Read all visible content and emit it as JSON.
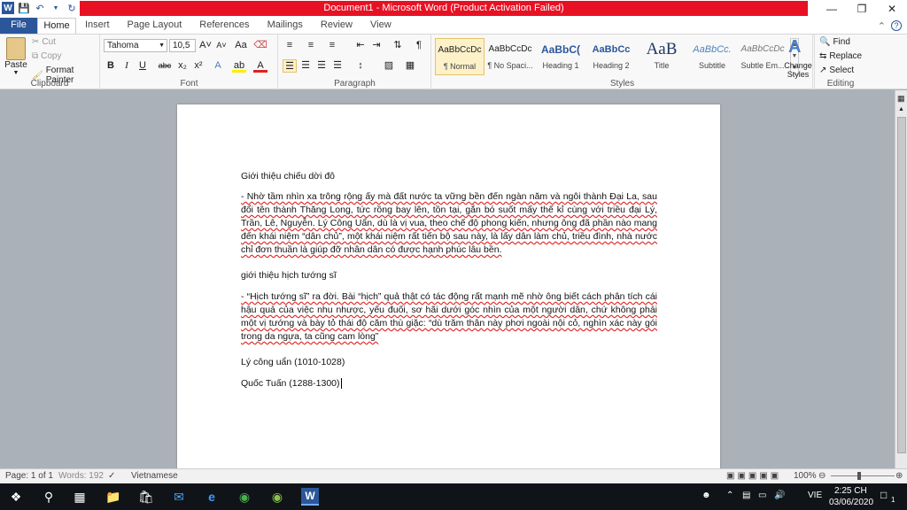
{
  "window": {
    "title": "Document1  -  Microsoft Word (Product Activation Failed)"
  },
  "tabs": [
    "File",
    "Home",
    "Insert",
    "Page Layout",
    "References",
    "Mailings",
    "Review",
    "View"
  ],
  "clipboard": {
    "paste": "Paste",
    "cut": "Cut",
    "copy": "Copy",
    "format_painter": "Format Painter",
    "label": "Clipboard"
  },
  "font": {
    "name": "Tahoma",
    "size": "10,5",
    "label": "Font"
  },
  "paragraph": {
    "label": "Paragraph"
  },
  "styles": {
    "label": "Styles",
    "items": [
      {
        "sample": "AaBbCcDc",
        "name": "¶ Normal"
      },
      {
        "sample": "AaBbCcDc",
        "name": "¶ No Spaci..."
      },
      {
        "sample": "AaBbC(",
        "name": "Heading 1"
      },
      {
        "sample": "AaBbCc",
        "name": "Heading 2"
      },
      {
        "sample": "AaB",
        "name": "Title"
      },
      {
        "sample": "AaBbCc.",
        "name": "Subtitle"
      },
      {
        "sample": "AaBbCcDc",
        "name": "Subtle Em..."
      }
    ],
    "change": "Change Styles"
  },
  "editing": {
    "find": "Find",
    "replace": "Replace",
    "select": "Select",
    "label": "Editing"
  },
  "document": {
    "p1": "Giới thiệu chiếu dời đô",
    "p2": "-     Nhờ tầm nhìn xa trông rộng ấy mà đất nước ta vững bền đến ngàn năm và ngôi thành Đại La, sau đổi tên thành Thăng Long, tức rồng bay lên, tồn tại, gắn bó suốt mấy thế kỉ cùng với triều đại Lý, Trần, Lê, Nguyễn. Lý Công Uẩn, dù là vị vua, theo chế độ phong kiến, nhưng ông đã phần nào mang đến khái niệm “dân chủ”, một khái niệm rất tiến bộ sau này, là lấy dân làm chủ, triều đình, nhà nước chỉ đơn thuần là giúp đỡ nhân dân có được hạnh phúc lâu bền.",
    "p3": "giới thiệu hịch tướng sĩ",
    "p4": "-     “Hịch tướng sĩ” ra đời. Bài “hịch” quả thật có tác động rất mạnh mẽ nhờ ông biết cách phân tích cái hậu quả của việc nhu nhược, yếu đuối, sơ hãi dưới góc nhìn của một người dân, chứ không phải một vị tướng và bày tỏ thái độ căm thù giặc: “dù trăm thân này phơi ngoài nội cỏ, nghìn xác này gói trong da ngựa, ta cũng cam lòng”",
    "p5": "Lý công uẩn (1010-1028)",
    "p6": "Quốc Tuấn (1288-1300)"
  },
  "status": {
    "page": "Page: 1 of 1",
    "words": "Words: 192",
    "language": "Vietnamese",
    "zoom": "100%"
  },
  "taskbar": {
    "lang": "VIE",
    "time": "2:25 CH",
    "date": "03/06/2020",
    "notif": "1"
  }
}
